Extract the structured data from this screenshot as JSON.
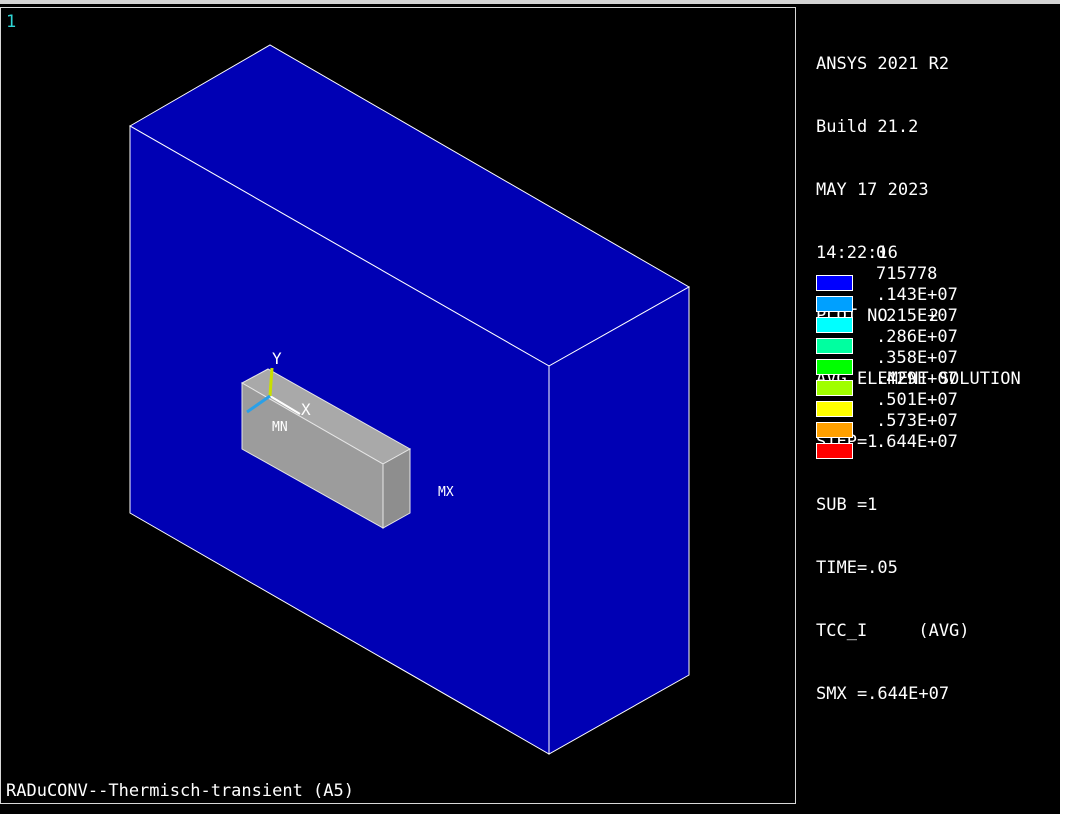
{
  "window": {
    "number": "1",
    "subtitle": "RADuCONV--Thermisch-transient (A5)"
  },
  "plot": {
    "box_color": "#0000b4",
    "block_color": "#a0a0a0",
    "edge_color": "#ffffff",
    "min_label": "MN",
    "max_label": "MX",
    "axis_y_label": "Y",
    "axis_x_label": "X",
    "axis_z_color": "#2aa0e8",
    "axis_y_color": "#c8e000"
  },
  "legend": {
    "lines": [
      "ANSYS 2021 R2",
      "Build 21.2",
      "MAY 17 2023",
      "14:22:16",
      "PLOT NO.   2",
      "AVG ELEMENT SOLUTION",
      "STEP=1",
      "SUB =1",
      "TIME=.05",
      "TCC_I     (AVG)",
      "SMX =.644E+07"
    ],
    "scale_min": "0",
    "bands": [
      {
        "label": "715778",
        "color": "#0000ff"
      },
      {
        "label": ".143E+07",
        "color": "#00a0ff"
      },
      {
        "label": ".215E+07",
        "color": "#00ffff"
      },
      {
        "label": ".286E+07",
        "color": "#00ffa0"
      },
      {
        "label": ".358E+07",
        "color": "#00ff00"
      },
      {
        "label": ".429E+07",
        "color": "#a0ff00"
      },
      {
        "label": ".501E+07",
        "color": "#ffff00"
      },
      {
        "label": ".573E+07",
        "color": "#ffa000"
      },
      {
        "label": ".644E+07",
        "color": "#ff0000"
      }
    ]
  }
}
